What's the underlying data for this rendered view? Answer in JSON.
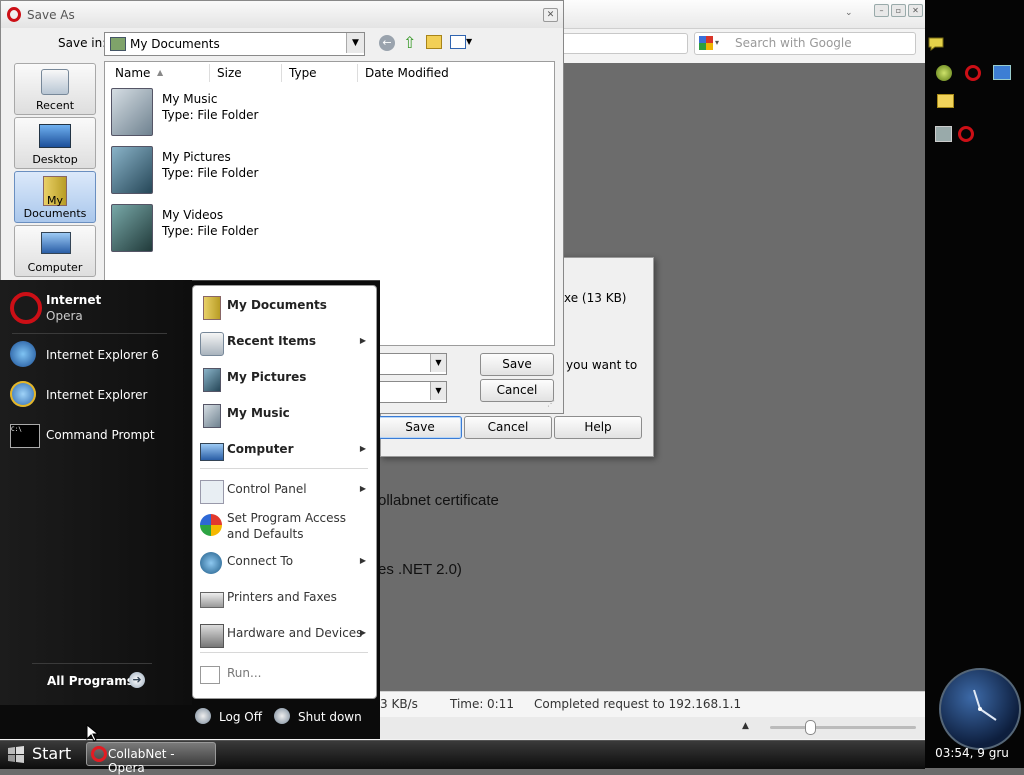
{
  "browser": {
    "search_placeholder": "Search with Google",
    "page_text_1": "ollabnet certificate",
    "page_text_2": "es .NET 2.0)",
    "status": {
      "speed": "3 KB/s",
      "time_label": "Time:",
      "time_value": "0:11",
      "message": "Completed request to 192.168.1.1"
    }
  },
  "download_dialog": {
    "size_text": "xe (13 KB)",
    "question_text": "you want to",
    "save_label": "Save",
    "cancel_label": "Cancel",
    "help_label": "Help"
  },
  "saveas": {
    "title": "Save As",
    "savein_label": "Save in:",
    "savein_value": "My Documents",
    "places": [
      {
        "label": "Recent"
      },
      {
        "label": "Desktop"
      },
      {
        "label": "My Documents"
      },
      {
        "label": "Computer"
      }
    ],
    "columns": [
      "Name",
      "Size",
      "Type",
      "Date Modified"
    ],
    "items": [
      {
        "name": "My Music",
        "type": "Type: File Folder"
      },
      {
        "name": "My Pictures",
        "type": "Type: File Folder"
      },
      {
        "name": "My Videos",
        "type": "Type: File Folder"
      }
    ],
    "save_label": "Save",
    "cancel_label": "Cancel"
  },
  "startmenu": {
    "pinned": [
      {
        "title": "Internet",
        "subtitle": "Opera"
      }
    ],
    "programs": [
      "Internet Explorer 6",
      "Internet Explorer",
      "Command Prompt"
    ],
    "all_programs": "All Programs",
    "right_items": [
      {
        "label": "My Documents",
        "bold": true
      },
      {
        "label": "Recent Items",
        "bold": true
      },
      {
        "label": "My Pictures",
        "bold": true
      },
      {
        "label": "My Music",
        "bold": true
      },
      {
        "label": "Computer",
        "bold": true
      },
      {
        "label": "Control Panel",
        "bold": false
      },
      {
        "label": "Set Program Access and Defaults",
        "bold": false
      },
      {
        "label": "Connect To",
        "bold": false
      },
      {
        "label": "Printers and Faxes",
        "bold": false
      },
      {
        "label": "Hardware and Devices",
        "bold": false
      },
      {
        "label": "Run...",
        "bold": false
      }
    ],
    "logoff": "Log Off",
    "shutdown": "Shut down"
  },
  "taskbar": {
    "start": "Start",
    "tasks": [
      "CollabNet - Opera"
    ],
    "clock": "03:54, 9 gru"
  },
  "colors": {
    "opera_red": "#cc0f16",
    "selection_blue": "#aac7ec"
  }
}
